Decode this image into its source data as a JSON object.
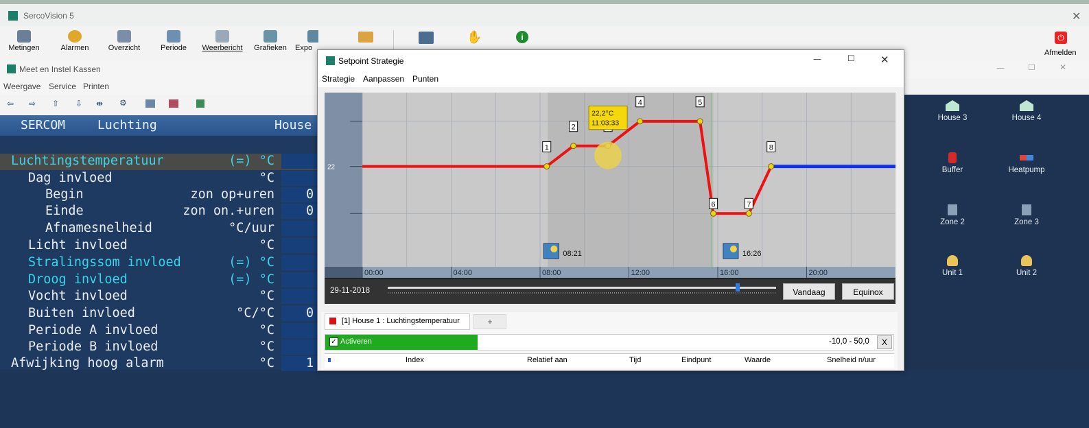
{
  "app": {
    "title": "SercoVision 5",
    "toolbar": [
      {
        "label": "Metingen",
        "icon": "metingen-icon"
      },
      {
        "label": "Alarmen",
        "icon": "alarm-icon"
      },
      {
        "label": "Overzicht",
        "icon": "overview-icon"
      },
      {
        "label": "Periode",
        "icon": "period-icon"
      },
      {
        "label": "Weerbericht",
        "icon": "weather-icon"
      },
      {
        "label": "Grafieken",
        "icon": "chart-icon"
      },
      {
        "label": "Expo",
        "icon": "export-icon"
      }
    ],
    "logout_label": "Afmelden"
  },
  "sub_window": {
    "title": "Meet en Instel Kassen",
    "menu": [
      "Weergave",
      "Service",
      "Printen"
    ],
    "header": {
      "left": "SERCOM",
      "middle": "Luchting",
      "right": "House"
    },
    "rows": [
      {
        "label": "Luchtingstemperatuur",
        "unit": "(=) °C",
        "value": "",
        "indent": 0,
        "cyan": true,
        "selected": true
      },
      {
        "label": "Dag invloed",
        "unit": "°C",
        "value": "",
        "indent": 1,
        "cyan": false
      },
      {
        "label": "Begin",
        "mid": "zon op+uren",
        "value": "0",
        "indent": 2,
        "cyan": false
      },
      {
        "label": "Einde",
        "mid": "zon on.+uren",
        "value": "0",
        "indent": 2,
        "cyan": false
      },
      {
        "label": "Afnamesnelheid",
        "unit": "°C/uur",
        "value": "",
        "indent": 2,
        "cyan": false
      },
      {
        "label": "Licht invloed",
        "unit": "°C",
        "value": "",
        "indent": 1,
        "cyan": false
      },
      {
        "label": "Stralingssom invloed",
        "unit": "(=) °C",
        "value": "",
        "indent": 1,
        "cyan": true
      },
      {
        "label": "Droog invloed",
        "unit": "(=) °C",
        "value": "",
        "indent": 1,
        "cyan": true
      },
      {
        "label": "Vocht invloed",
        "unit": "°C",
        "value": "",
        "indent": 1,
        "cyan": false
      },
      {
        "label": "Buiten invloed",
        "unit": "°C/°C",
        "value": "0",
        "indent": 1,
        "cyan": false
      },
      {
        "label": "Periode A invloed",
        "unit": "°C",
        "value": "",
        "indent": 1,
        "cyan": false
      },
      {
        "label": "Periode B invloed",
        "unit": "°C",
        "value": "",
        "indent": 1,
        "cyan": false
      },
      {
        "label": "Afwijking hoog alarm",
        "unit": "°C",
        "value": "1",
        "indent": 0,
        "cyan": false
      }
    ]
  },
  "devices": [
    {
      "label": "House 3",
      "icon": "greenhouse-icon"
    },
    {
      "label": "House 4",
      "icon": "greenhouse-icon"
    },
    {
      "label": "Buffer",
      "icon": "buffer-icon"
    },
    {
      "label": "Heatpump",
      "icon": "heatpump-icon"
    },
    {
      "label": "Zone 2",
      "icon": "zone-icon"
    },
    {
      "label": "Zone 3",
      "icon": "zone-icon"
    },
    {
      "label": "Unit 1",
      "icon": "unit-icon"
    },
    {
      "label": "Unit 2",
      "icon": "unit-icon"
    }
  ],
  "dialog": {
    "title": "Setpoint Strategie",
    "menu": [
      "Strategie",
      "Aanpassen",
      "Punten"
    ],
    "date": "29-11-2018",
    "today_button": "Vandaag",
    "equinox_button": "Equinox",
    "tab_label": "[1] House 1 : Luchtingstemperatuur",
    "tab_add": "+",
    "activate_label": "Activeren",
    "range_label": "-10,0 - 50,0",
    "range_clear": "X",
    "table_headers": [
      "Index",
      "Relatief aan",
      "Tijd",
      "Eindpunt",
      "Waarde",
      "Snelheid n/uur"
    ],
    "sunrise_time": "08:21",
    "sunset_time": "16:26",
    "tooltip": {
      "temp": "22,2°C",
      "time": "11:03:33"
    },
    "colors": {
      "strategy_line": "#ee1111",
      "future_line": "#1133ee",
      "active_bar": "#1faa1f"
    }
  },
  "chart_data": {
    "type": "line",
    "y_label_tick": "22",
    "x_ticks": [
      "00:00",
      "04:00",
      "08:00",
      "12:00",
      "16:00",
      "20:00"
    ],
    "points": [
      {
        "index": "1",
        "x": 8.3,
        "y": 22.0
      },
      {
        "index": "2",
        "x": 9.5,
        "y": 23.0
      },
      {
        "index": "3",
        "x": 11.06,
        "y": 23.0
      },
      {
        "index": "4",
        "x": 12.5,
        "y": 24.2
      },
      {
        "index": "5",
        "x": 15.2,
        "y": 24.2
      },
      {
        "index": "6",
        "x": 15.8,
        "y": 19.7
      },
      {
        "index": "7",
        "x": 17.4,
        "y": 19.7
      },
      {
        "index": "8",
        "x": 18.4,
        "y": 22.0
      }
    ],
    "start_value": 22.0,
    "end_value": 22.0,
    "x_range": [
      -1.7,
      24
    ],
    "y_range": [
      17.1,
      25.6
    ]
  }
}
